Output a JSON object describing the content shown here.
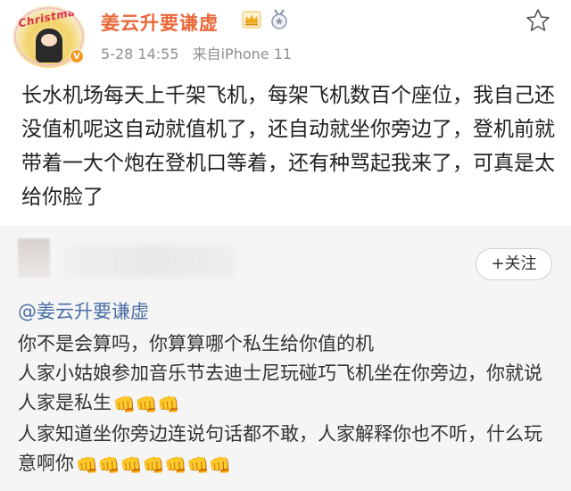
{
  "post": {
    "avatar_caption": "Christmas",
    "vip_mark": "V",
    "username": "姜云升要谦虚",
    "time": "5-28 14:55",
    "source": "来自iPhone 11",
    "body": "长水机场每天上千架飞机，每架飞机数百个座位，我自己还没值机呢这自动就值机了，还自动就坐你旁边了，登机前就带着一大个炮在登机口等着，还有种骂起我来了，可真是太给你脸了"
  },
  "comment": {
    "follow_label": "+关注",
    "mention": "@姜云升要谦虚",
    "lines": [
      "你不是会算吗，你算算哪个私生给你值的机",
      "人家小姑娘参加音乐节去迪士尼玩碰巧飞机坐在你旁边，你就说人家是私生",
      "人家知道坐你旁边连说句话都不敢，人家解释你也不听，什么玩意啊你"
    ],
    "line2_emoji": "👊👊👊",
    "line3_emoji": "👊👊👊👊👊👊👊"
  },
  "colors": {
    "username": "#e8683a",
    "mention": "#4a6fa5",
    "meta": "#8f8f8f",
    "comment_bg": "#f5f5f5"
  },
  "icons": [
    "star-icon",
    "crown-badge-icon",
    "medal-badge-icon",
    "fist-emoji-icon"
  ]
}
